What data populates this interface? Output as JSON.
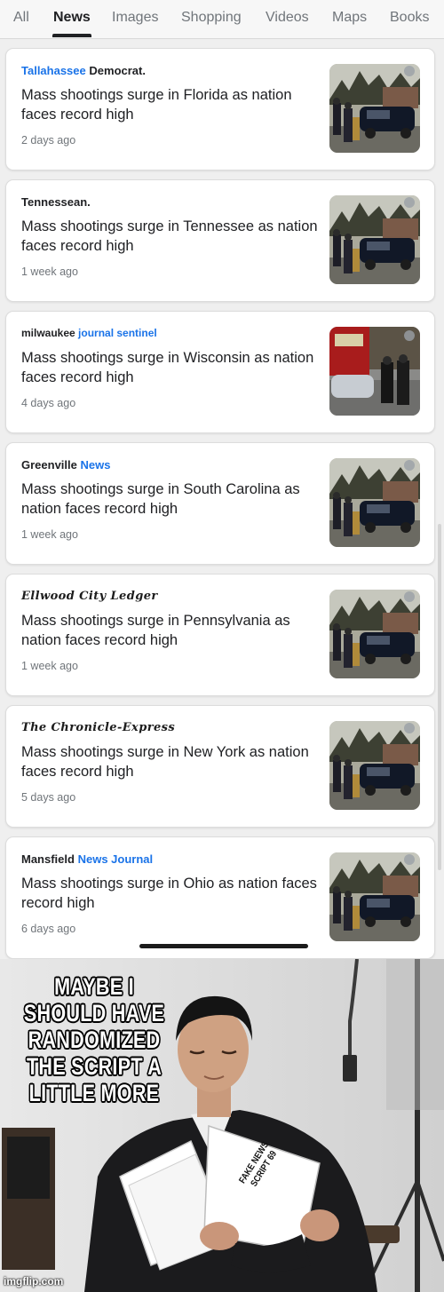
{
  "tabs": [
    {
      "label": "All",
      "active": false
    },
    {
      "label": "News",
      "active": true
    },
    {
      "label": "Images",
      "active": false
    },
    {
      "label": "Shopping",
      "active": false
    },
    {
      "label": "Videos",
      "active": false
    },
    {
      "label": "Maps",
      "active": false
    },
    {
      "label": "Books",
      "active": false
    }
  ],
  "articles": [
    {
      "source_a": "Tallahassee",
      "source_b": "Democrat.",
      "headline": "Mass shootings surge in Florida as nation faces record high",
      "age": "2 days ago"
    },
    {
      "source_a": "Tennessean.",
      "source_b": "",
      "headline": "Mass shootings surge in Tennessee as nation faces record high",
      "age": "1 week ago"
    },
    {
      "source_a": "milwaukee",
      "source_b": "journal sentinel",
      "headline": "Mass shootings surge in Wisconsin as nation faces record high",
      "age": "4 days ago"
    },
    {
      "source_a": "Greenville",
      "source_b": "News",
      "headline": "Mass shootings surge in South Carolina as nation faces record high",
      "age": "1 week ago"
    },
    {
      "source_a": "Ellwood City Ledger",
      "source_b": "",
      "headline": "Mass shootings surge in Pennsylvania as nation faces record high",
      "age": "1 week ago"
    },
    {
      "source_a": "The Chronicle-Express",
      "source_b": "",
      "headline": "Mass shootings surge in New York as nation faces record high",
      "age": "5 days ago"
    },
    {
      "source_a": "Mansfield",
      "source_b": "News Journal",
      "headline": "Mass shootings surge in Ohio as nation faces record high",
      "age": "6 days ago"
    }
  ],
  "meme": {
    "caption": "MAYBE I SHOULD HAVE RANDOMIZED THE SCRIPT A LITTLE MORE",
    "paper_text": "FAKE NEWS SCRIPT 69",
    "watermark": "imgflip.com"
  },
  "colors": {
    "accent": "#1a73e8",
    "text": "#202124",
    "muted": "#70757a"
  }
}
